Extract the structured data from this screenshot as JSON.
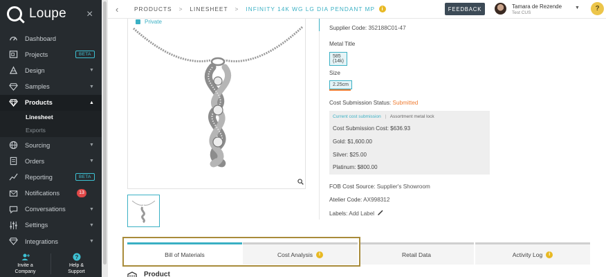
{
  "app": {
    "name": "Loupe"
  },
  "sidebar": {
    "items": [
      {
        "label": "Dashboard",
        "icon": "dashboard-icon"
      },
      {
        "label": "Projects",
        "icon": "projects-icon",
        "badge": "BETA"
      },
      {
        "label": "Design",
        "icon": "design-icon",
        "caret": "▼"
      },
      {
        "label": "Samples",
        "icon": "diamond-icon",
        "caret": "▼"
      },
      {
        "label": "Products",
        "icon": "gem-icon",
        "caret": "▲",
        "active": true
      },
      {
        "label": "Sourcing",
        "icon": "globe-icon",
        "caret": "▼"
      },
      {
        "label": "Orders",
        "icon": "orders-icon",
        "caret": "▼"
      },
      {
        "label": "Reporting",
        "icon": "chart-icon",
        "badge": "BETA"
      },
      {
        "label": "Notifications",
        "icon": "mail-icon",
        "count": "13"
      },
      {
        "label": "Conversations",
        "icon": "chat-icon",
        "caret": "▼"
      },
      {
        "label": "Settings",
        "icon": "sliders-icon",
        "caret": "▼"
      },
      {
        "label": "Integrations",
        "icon": "integrations-icon",
        "caret": "▼"
      }
    ],
    "subitems": [
      {
        "label": "Linesheet",
        "active": true
      },
      {
        "label": "Exports",
        "active": false
      }
    ],
    "footer": {
      "invite_line1": "Invite a",
      "invite_line2": "Company",
      "help_line1": "Help &",
      "help_line2": "Support"
    },
    "close_glyph": "×"
  },
  "topbar": {
    "back_glyph": "‹",
    "crumbs": [
      "PRODUCTS",
      "LINESHEET",
      "INFINITY 14K WG LG DIA PENDANT MP"
    ],
    "crumb_sep": ">",
    "info_glyph": "i",
    "feedback_label": "FEEDBACK",
    "user_name": "Tamara de Rezende",
    "user_sub": "Test CUS",
    "user_caret": "▼",
    "help_glyph": "?"
  },
  "product": {
    "private_label": "Private",
    "supplier_code_label": "Supplier Code:",
    "supplier_code": "352188C01-47",
    "metal_title_label": "Metal Title",
    "metal_chip": "585 (14k)",
    "size_label": "Size",
    "size_chip": "2.25cm",
    "cost_status_label": "Cost Submission Status:",
    "cost_status_value": "Submitted",
    "cost_panel": {
      "tab_current": "Current cost submission",
      "tab_sep": "|",
      "tab_other": "Assortment metal lock",
      "lines": [
        {
          "label": "Cost Submission Cost:",
          "value": "$636.93"
        },
        {
          "label": "Gold:",
          "value": "$1,600.00"
        },
        {
          "label": "Silver:",
          "value": "$25.00"
        },
        {
          "label": "Platinum:",
          "value": "$800.00"
        }
      ]
    },
    "fob_label": "FOB Cost Source:",
    "fob_value": "Supplier's Showroom",
    "atelier_label": "Atelier Code:",
    "atelier_value": "AX998312",
    "labels_label": "Labels:",
    "add_label": "Add Label"
  },
  "tabs": [
    {
      "label": "Bill of Materials",
      "active": true,
      "info": false
    },
    {
      "label": "Cost Analysis",
      "active": false,
      "info": true
    },
    {
      "label": "Retail Data",
      "active": false,
      "info": false
    },
    {
      "label": "Activity Log",
      "active": false,
      "info": true
    }
  ],
  "tab_info_glyph": "i",
  "section_peek": "Product",
  "colors": {
    "accent": "#3ab0c4",
    "sidebar_bg": "#262b2f",
    "status_orange": "#ee7b30",
    "info_yellow": "#e8b923",
    "highlight_gold": "#a88b3a"
  }
}
